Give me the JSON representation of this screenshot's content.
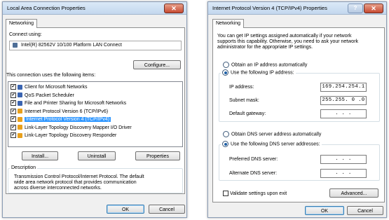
{
  "left_dialog": {
    "title": "Local Area Connection Properties",
    "close_glyph": "✕",
    "tab": "Networking",
    "connect_using_label": "Connect using:",
    "adapter_name": "Intel(R) 82562V 10/100 Platform LAN Connect",
    "configure_button": "Configure...",
    "items_label": "This connection uses the following items:",
    "items": [
      {
        "label": "Client for Microsoft Networks",
        "checked": true,
        "icon_color": "#3a64b0"
      },
      {
        "label": "QoS Packet Scheduler",
        "checked": true,
        "icon_color": "#3a64b0"
      },
      {
        "label": "File and Printer Sharing for Microsoft Networks",
        "checked": true,
        "icon_color": "#3a64b0"
      },
      {
        "label": "Internet Protocol Version 6 (TCP/IPv6)",
        "checked": true,
        "icon_color": "#e8a01c"
      },
      {
        "label": "Internet Protocol Version 4 (TCP/IPv4)",
        "checked": true,
        "icon_color": "#e8a01c",
        "selected": true
      },
      {
        "label": "Link-Layer Topology Discovery Mapper I/O Driver",
        "checked": true,
        "icon_color": "#e8a01c"
      },
      {
        "label": "Link-Layer Topology Discovery Responder",
        "checked": true,
        "icon_color": "#e8a01c"
      }
    ],
    "install_button": "Install...",
    "uninstall_button": "Uninstall",
    "properties_button": "Properties",
    "description_legend": "Description",
    "description_text": [
      "Transmission Control Protocol/Internet Protocol. The default",
      "wide area network protocol that provides communication",
      "across diverse interconnected networks."
    ],
    "ok_button": "OK",
    "cancel_button": "Cancel"
  },
  "right_dialog": {
    "title": "Internet Protocol Version 4 (TCP/IPv4) Properties",
    "help_glyph": "?",
    "close_glyph": "✕",
    "tab": "Networking",
    "intro_text": [
      "You can get IP settings assigned automatically if your network",
      "supports this capability. Otherwise, you need to ask your network",
      "administrator for the appropriate IP settings."
    ],
    "radio_auto_ip": "Obtain an IP address automatically",
    "radio_manual_ip": "Use the following IP address:",
    "ip_label": "IP address:",
    "ip_value": "169.254.254.1",
    "subnet_label": "Subnet mask:",
    "subnet_value": "255.255. 0 .0",
    "gateway_label": "Default gateway:",
    "gateway_value": ".     .     .",
    "radio_auto_dns": "Obtain DNS server address automatically",
    "radio_manual_dns": "Use the following DNS server addresses:",
    "preferred_dns_label": "Preferred DNS server:",
    "preferred_dns_value": ".     .     .",
    "alternate_dns_label": "Alternate DNS server:",
    "alternate_dns_value": ".     .     .",
    "validate_label": "Validate settings upon exit",
    "advanced_button": "Advanced...",
    "ok_button": "OK",
    "cancel_button": "Cancel"
  }
}
